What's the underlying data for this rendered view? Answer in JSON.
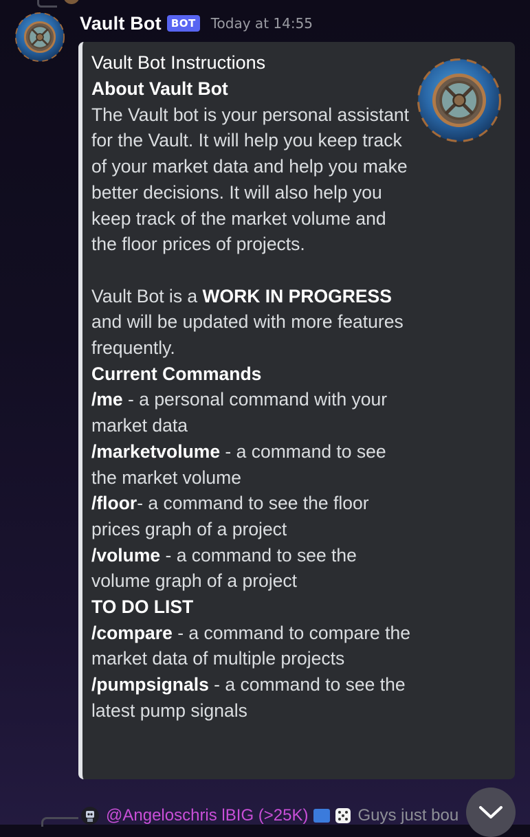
{
  "message": {
    "author": "Vault Bot",
    "badge": "BOT",
    "timestamp": "Today at 14:55",
    "avatar_icon": "vault-door-icon"
  },
  "embed": {
    "accent_color": "#e3e5e8",
    "title": "Vault Bot Instructions",
    "thumbnail_icon": "vault-door-icon",
    "about_heading": "About Vault Bot",
    "about_text": "The Vault bot is your personal assistant for the Vault. It will help you keep track of your market data and help you make better decisions. It will also help you keep track of the market volume and the floor prices of projects.",
    "wip_prefix": "Vault Bot is a ",
    "wip_bold": "WORK IN PROGRESS",
    "wip_suffix": " and will be updated with more features frequently.",
    "current_heading": "Current Commands",
    "current_commands": [
      {
        "name": "/me",
        "desc": " - a personal command with your market data"
      },
      {
        "name": "/marketvolume",
        "desc": " - a command to see the market volume"
      },
      {
        "name": "/floor",
        "desc": "- a command to see the floor prices graph of a project"
      },
      {
        "name": "/volume",
        "desc": " - a command to see the volume graph of a project"
      }
    ],
    "todo_heading": "TO DO LIST",
    "todo_commands": [
      {
        "name": "/compare",
        "desc": " - a command to compare the market data of multiple projects"
      },
      {
        "name": "/pumpsignals",
        "desc": " - a command to see the latest pump signals"
      }
    ]
  },
  "next_message": {
    "author": "@Angeloschris lBIG (>25K)",
    "preview": "Guys just bou"
  },
  "scroll_button": {
    "icon": "chevron-down-icon"
  }
}
